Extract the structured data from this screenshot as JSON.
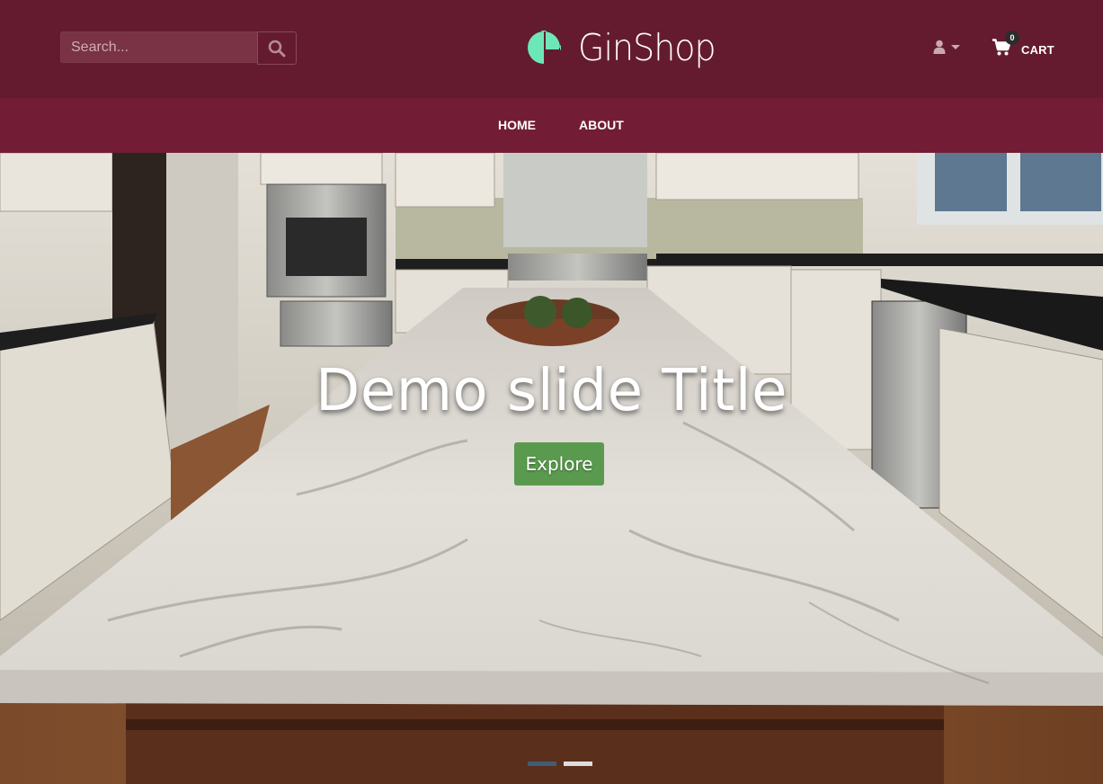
{
  "header": {
    "search_placeholder": "Search...",
    "brand": "GinShop",
    "cart_label": "CART",
    "cart_count": "0"
  },
  "nav": {
    "items": [
      {
        "label": "HOME"
      },
      {
        "label": "ABOUT"
      }
    ]
  },
  "slider": {
    "title": "Demo slide Title",
    "button_label": "Explore",
    "slide_count": 2,
    "active_slide": 1
  },
  "colors": {
    "header_bg": "#641b30",
    "nav_bg": "#721d35",
    "logo_accent": "#6ee7b7",
    "button_green": "#5a9a4e"
  },
  "icons": {
    "search": "search-icon",
    "logo": "logo-g-icon",
    "user": "user-icon",
    "cart": "shopping-cart-icon"
  }
}
